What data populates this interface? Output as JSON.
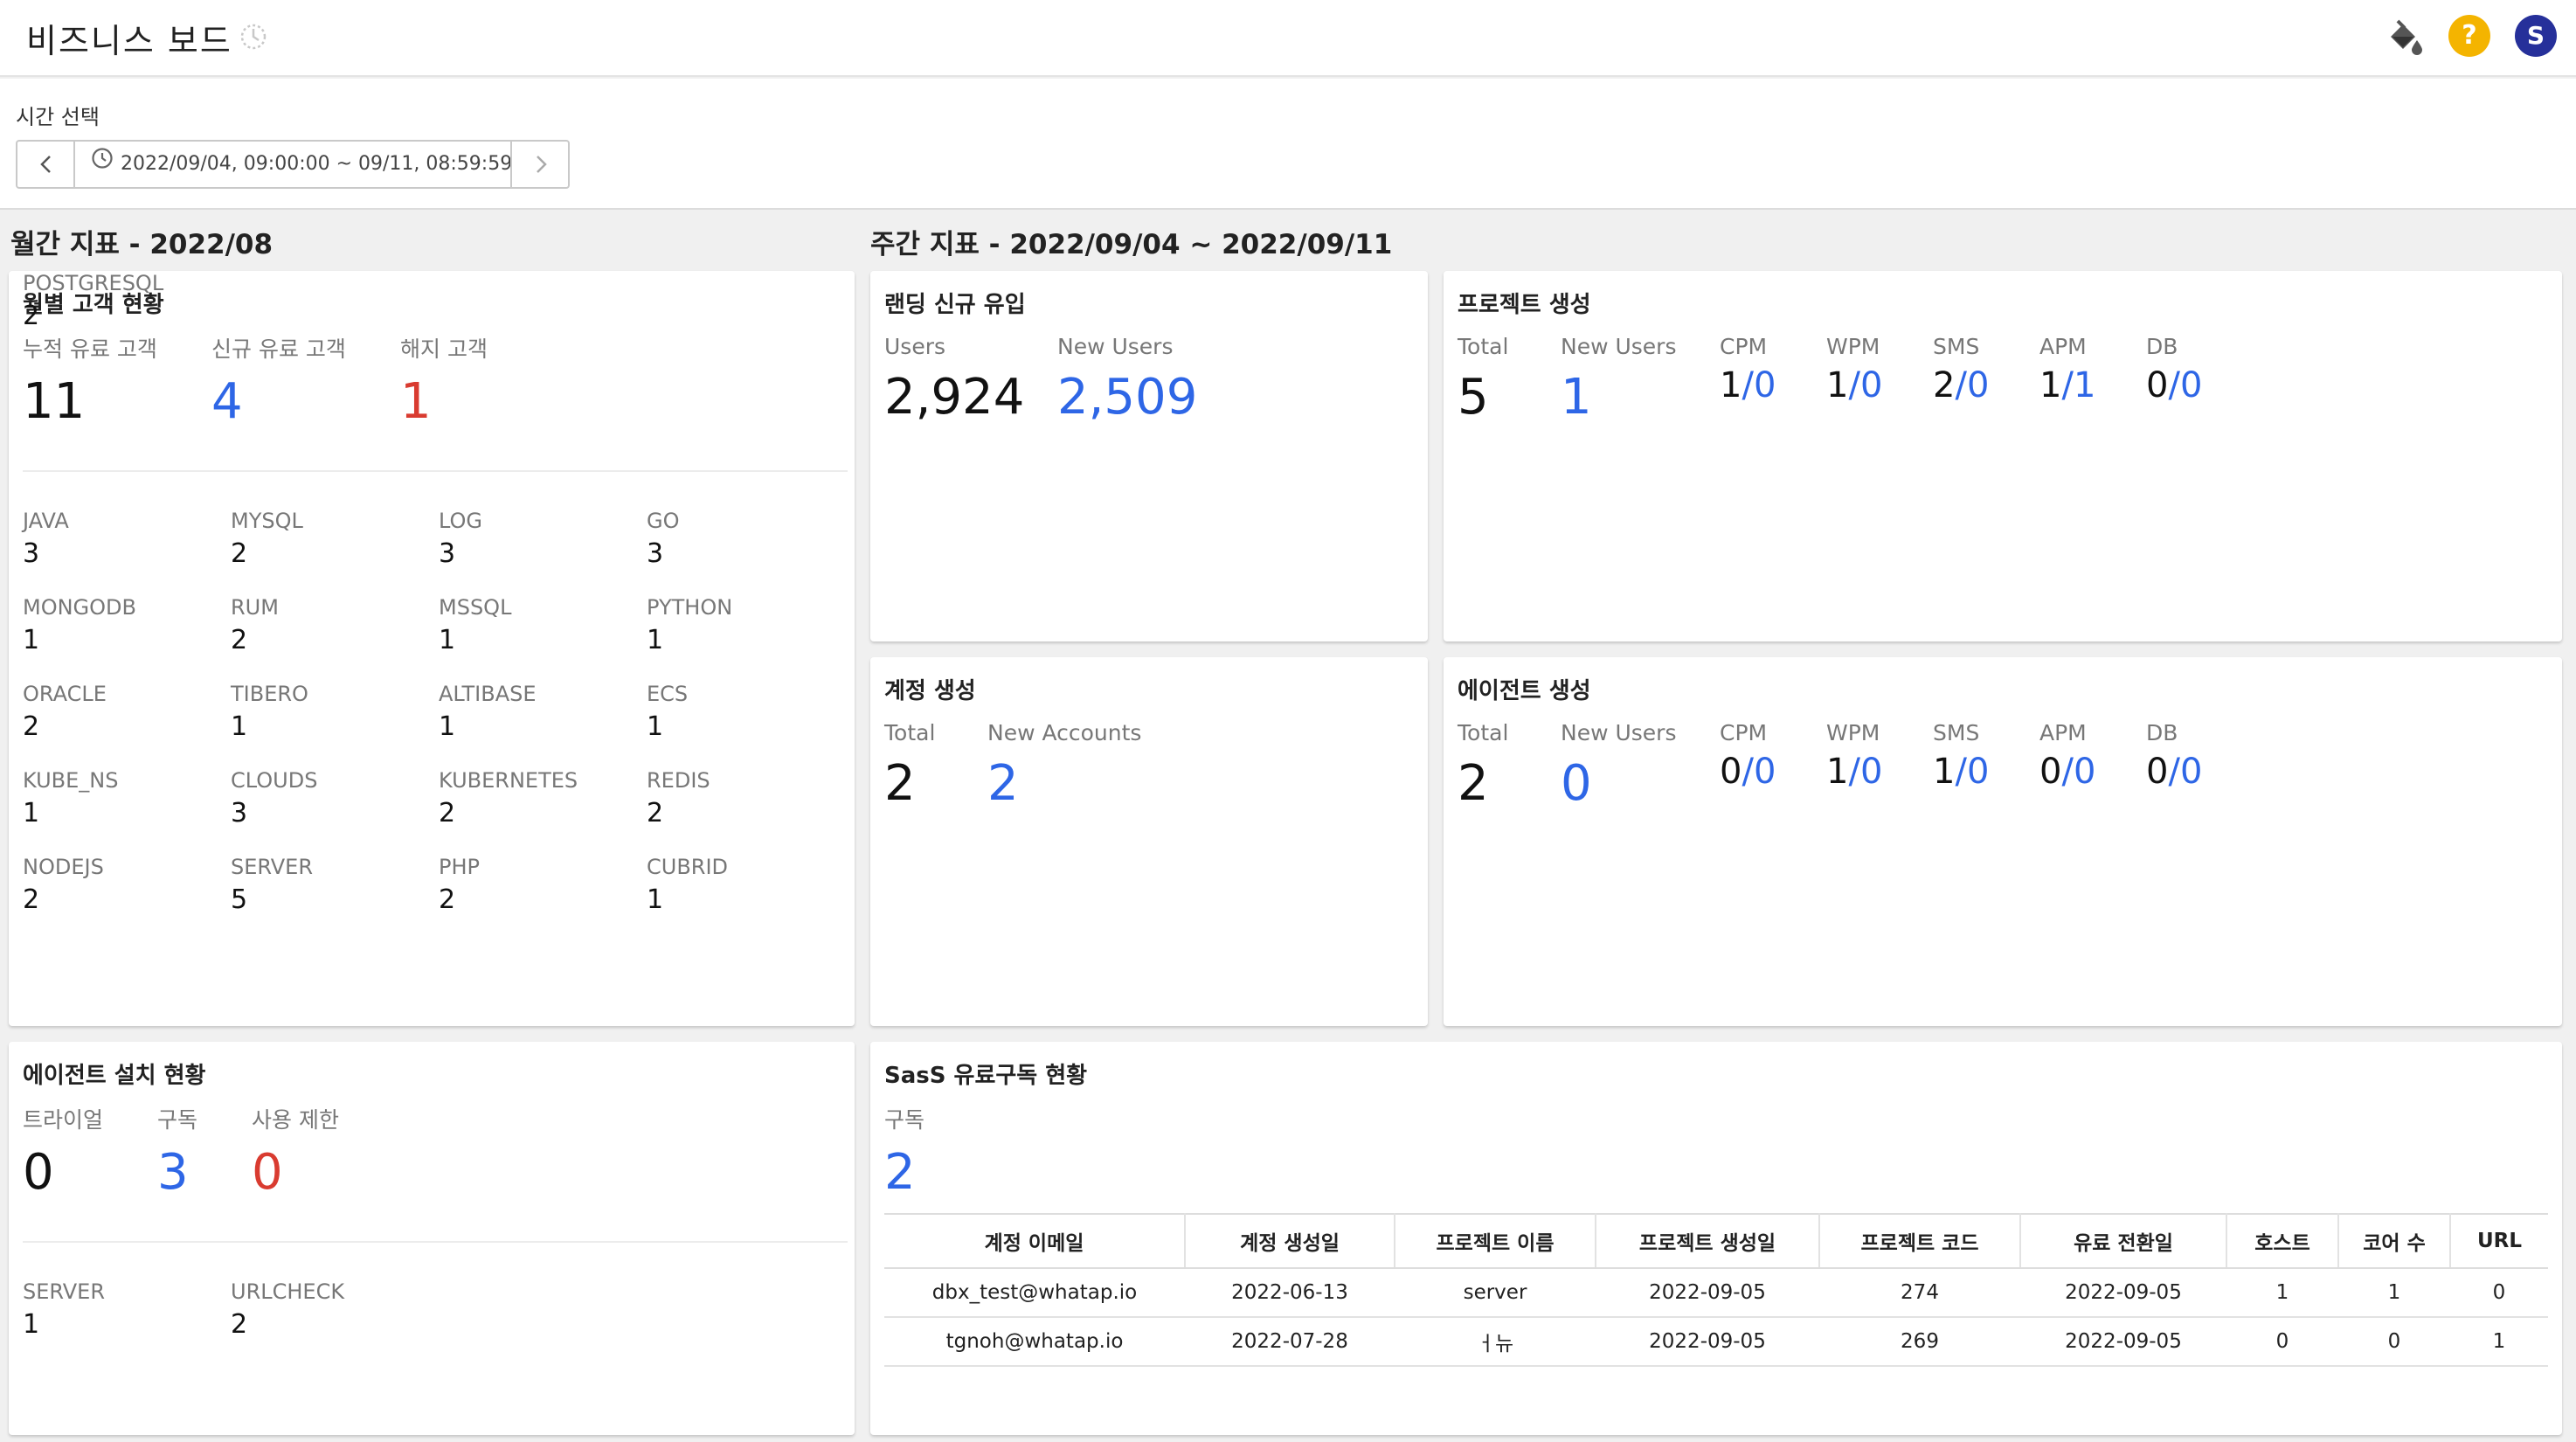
{
  "header": {
    "title": "비즈니스 보드",
    "avatar_initial": "S",
    "help_glyph": "?",
    "icons": [
      "refresh-icon",
      "paint-bucket-icon",
      "help-icon",
      "avatar"
    ],
    "colors": {
      "help": "#f4b400",
      "avatar": "#26309a",
      "accent_blue": "#2e66e6",
      "accent_red": "#d93b30"
    }
  },
  "time_select": {
    "label": "시간 선택",
    "range": "2022/09/04, 09:00:00 ~ 09/11, 08:59:59"
  },
  "monthly": {
    "section_title": "월간 지표  - 2022/08",
    "customers": {
      "title": "월별 고객 현황",
      "metrics": [
        {
          "label": "누적 유료 고객",
          "value": "11"
        },
        {
          "label": "신규 유료 고객",
          "value": "4"
        },
        {
          "label": "해지 고객",
          "value": "1"
        }
      ],
      "products": [
        {
          "label": "JAVA",
          "value": "3"
        },
        {
          "label": "MYSQL",
          "value": "2"
        },
        {
          "label": "LOG",
          "value": "3"
        },
        {
          "label": "GO",
          "value": "3"
        },
        {
          "label": "MONGODB",
          "value": "1"
        },
        {
          "label": "RUM",
          "value": "2"
        },
        {
          "label": "MSSQL",
          "value": "1"
        },
        {
          "label": "PYTHON",
          "value": "1"
        },
        {
          "label": "ORACLE",
          "value": "2"
        },
        {
          "label": "TIBERO",
          "value": "1"
        },
        {
          "label": "ALTIBASE",
          "value": "1"
        },
        {
          "label": "ECS",
          "value": "1"
        },
        {
          "label": "KUBE_NS",
          "value": "1"
        },
        {
          "label": "CLOUDS",
          "value": "3"
        },
        {
          "label": "KUBERNETES",
          "value": "2"
        },
        {
          "label": "REDIS",
          "value": "2"
        },
        {
          "label": "NODEJS",
          "value": "2"
        },
        {
          "label": "SERVER",
          "value": "5"
        },
        {
          "label": "PHP",
          "value": "2"
        },
        {
          "label": "CUBRID",
          "value": "1"
        },
        {
          "label": "POSTGRESQL",
          "value": "2"
        }
      ]
    },
    "agent_install": {
      "title": "에이전트 설치 현황",
      "metrics": [
        {
          "label": "트라이얼",
          "value": "0"
        },
        {
          "label": "구독",
          "value": "3"
        },
        {
          "label": "사용 제한",
          "value": "0"
        }
      ],
      "items": [
        {
          "label": "SERVER",
          "value": "1"
        },
        {
          "label": "URLCHECK",
          "value": "2"
        }
      ]
    }
  },
  "weekly": {
    "section_title": "주간 지표  - 2022/09/04 ~ 2022/09/11",
    "landing": {
      "title": "랜딩 신규 유입",
      "metrics": [
        {
          "label": "Users",
          "value": "2,924"
        },
        {
          "label": "New Users",
          "value": "2,509"
        }
      ]
    },
    "project_creation": {
      "title": "프로젝트 생성",
      "total": {
        "label": "Total",
        "value": "5"
      },
      "new_users": {
        "label": "New Users",
        "value": "1"
      },
      "types": [
        {
          "label": "CPM",
          "a": "1",
          "b": "0"
        },
        {
          "label": "WPM",
          "a": "1",
          "b": "0"
        },
        {
          "label": "SMS",
          "a": "2",
          "b": "0"
        },
        {
          "label": "APM",
          "a": "1",
          "b": "1"
        },
        {
          "label": "DB",
          "a": "0",
          "b": "0"
        }
      ]
    },
    "account_creation": {
      "title": "계정 생성",
      "metrics": [
        {
          "label": "Total",
          "value": "2"
        },
        {
          "label": "New Accounts",
          "value": "2"
        }
      ]
    },
    "agent_creation": {
      "title": "에이전트 생성",
      "total": {
        "label": "Total",
        "value": "2"
      },
      "new_users": {
        "label": "New Users",
        "value": "0"
      },
      "types": [
        {
          "label": "CPM",
          "a": "0",
          "b": "0"
        },
        {
          "label": "WPM",
          "a": "1",
          "b": "0"
        },
        {
          "label": "SMS",
          "a": "1",
          "b": "0"
        },
        {
          "label": "APM",
          "a": "0",
          "b": "0"
        },
        {
          "label": "DB",
          "a": "0",
          "b": "0"
        }
      ]
    },
    "saas": {
      "title": "SasS 유료구독 현황",
      "metric": {
        "label": "구독",
        "value": "2"
      },
      "columns": [
        "계정 이메일",
        "계정 생성일",
        "프로젝트 이름",
        "프로젝트 생성일",
        "프로젝트 코드",
        "유료 전환일",
        "호스트",
        "코어 수",
        "URL"
      ],
      "rows": [
        [
          "dbx_test@whatap.io",
          "2022-06-13",
          "server",
          "2022-09-05",
          "274",
          "2022-09-05",
          "1",
          "1",
          "0"
        ],
        [
          "tgnoh@whatap.io",
          "2022-07-28",
          "ㅓ뉴",
          "2022-09-05",
          "269",
          "2022-09-05",
          "0",
          "0",
          "1"
        ]
      ]
    }
  }
}
